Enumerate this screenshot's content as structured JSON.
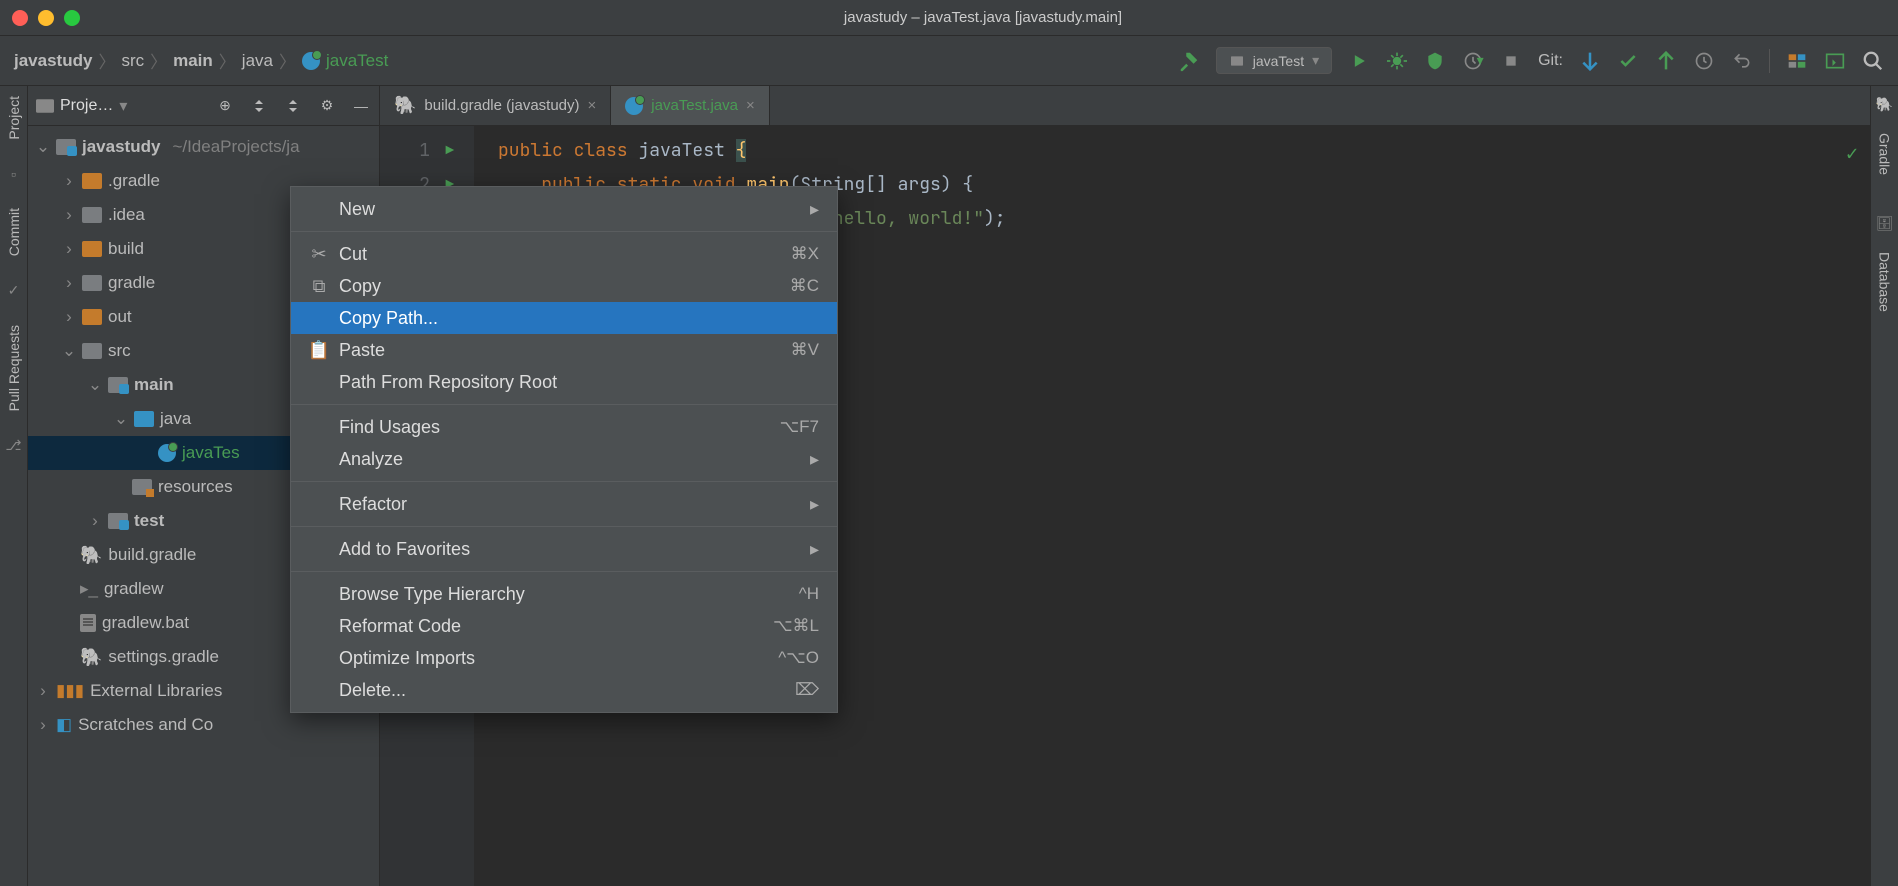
{
  "window": {
    "title": "javastudy – javaTest.java [javastudy.main]"
  },
  "breadcrumb": {
    "items": [
      "javastudy",
      "src",
      "main",
      "java",
      "javaTest"
    ],
    "bold_indices": [
      0,
      2
    ]
  },
  "run_config": {
    "label": "javaTest"
  },
  "toolbar": {
    "git_label": "Git:"
  },
  "project_panel": {
    "title": "Proje…",
    "root": {
      "label": "javastudy",
      "path": "~/IdeaProjects/ja"
    },
    "nodes": {
      "gradle_dir": ".gradle",
      "idea_dir": ".idea",
      "build_dir": "build",
      "gradle2_dir": "gradle",
      "out_dir": "out",
      "src_dir": "src",
      "main_dir": "main",
      "java_dir": "java",
      "javatest_file": "javaTes",
      "resources_dir": "resources",
      "test_dir": "test",
      "build_gradle": "build.gradle",
      "gradlew": "gradlew",
      "gradlew_bat": "gradlew.bat",
      "settings_gradle": "settings.gradle",
      "ext_libs": "External Libraries",
      "scratches": "Scratches and Co"
    }
  },
  "tabs": [
    {
      "label": "build.gradle (javastudy)",
      "active": false,
      "icon": "elephant"
    },
    {
      "label": "javaTest.java",
      "active": true,
      "icon": "class"
    }
  ],
  "code": {
    "l1_pre": "public class",
    "l1_cls": " javaTest ",
    "l1_brace": "{",
    "l2_pre": "    public static void ",
    "l2_fn": "main",
    "l2_post": "(String[] args) {",
    "l3_pre": "                              ",
    "l3_str": "\"hello, world!\"",
    "l3_post": ");"
  },
  "context_menu": {
    "items": [
      {
        "label": "New",
        "arrow": true
      },
      {
        "sep": true
      },
      {
        "label": "Cut",
        "shortcut": "⌘X",
        "icon": "cut"
      },
      {
        "label": "Copy",
        "shortcut": "⌘C",
        "icon": "copy"
      },
      {
        "label": "Copy Path...",
        "highlight": true
      },
      {
        "label": "Paste",
        "shortcut": "⌘V",
        "icon": "paste"
      },
      {
        "label": "Path From Repository Root"
      },
      {
        "sep": true
      },
      {
        "label": "Find Usages",
        "shortcut": "⌥F7"
      },
      {
        "label": "Analyze",
        "arrow": true
      },
      {
        "sep": true
      },
      {
        "label": "Refactor",
        "arrow": true
      },
      {
        "sep": true
      },
      {
        "label": "Add to Favorites",
        "arrow": true
      },
      {
        "sep": true
      },
      {
        "label": "Browse Type Hierarchy",
        "shortcut": "^H"
      },
      {
        "label": "Reformat Code",
        "shortcut": "⌥⌘L"
      },
      {
        "label": "Optimize Imports",
        "shortcut": "^⌥O"
      },
      {
        "label": "Delete...",
        "shortcut": "⌦"
      }
    ]
  },
  "left_tools": [
    "Project",
    "Commit",
    "Pull Requests"
  ],
  "right_tools": [
    "Gradle",
    "Database"
  ]
}
